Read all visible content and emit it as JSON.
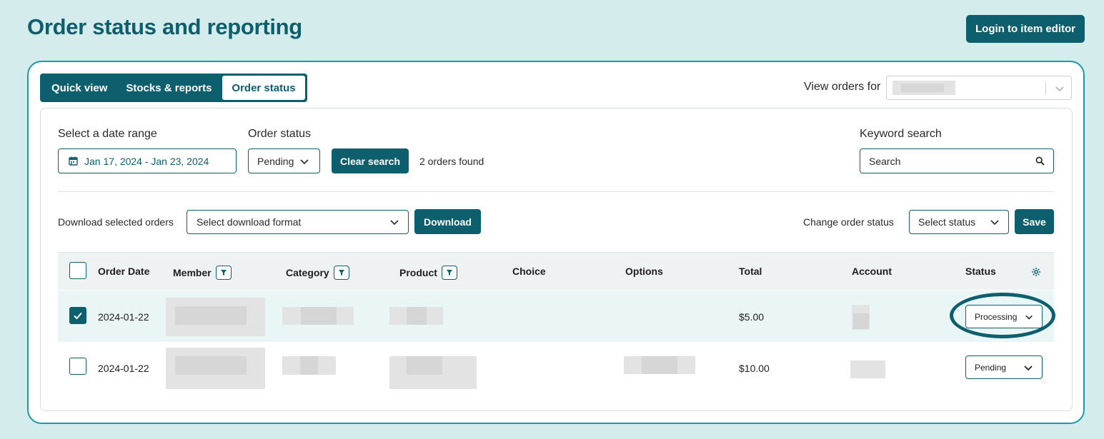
{
  "page_title": "Order status and reporting",
  "header": {
    "login_button": "Login to item editor"
  },
  "tabs": [
    {
      "label": "Quick view",
      "active": false
    },
    {
      "label": "Stocks & reports",
      "active": false
    },
    {
      "label": "Order status",
      "active": true
    }
  ],
  "view_orders": {
    "label": "View orders for"
  },
  "filters": {
    "date_range_label": "Select a date range",
    "date_range_value": "Jan 17, 2024 - Jan 23, 2024",
    "order_status_label": "Order status",
    "order_status_value": "Pending",
    "clear_search": "Clear search",
    "orders_found": "2 orders found",
    "keyword_label": "Keyword search",
    "keyword_placeholder": "Search"
  },
  "actions": {
    "download_label": "Download selected orders",
    "download_format_placeholder": "Select download format",
    "download_button": "Download",
    "change_status_label": "Change order status",
    "change_status_placeholder": "Select status",
    "save_button": "Save"
  },
  "table": {
    "columns": [
      "Order Date",
      "Member",
      "Category",
      "Product",
      "Choice",
      "Options",
      "Total",
      "Account",
      "Status"
    ],
    "rows": [
      {
        "selected": true,
        "order_date": "2024-01-22",
        "total": "$5.00",
        "status": "Processing"
      },
      {
        "selected": false,
        "order_date": "2024-01-22",
        "total": "$10.00",
        "status": "Pending"
      }
    ]
  },
  "colors": {
    "accent": "#0e5f6e",
    "page_bg": "#d4ecec",
    "card_border": "#1a9aa8",
    "selected_row": "#eaf5f5"
  }
}
